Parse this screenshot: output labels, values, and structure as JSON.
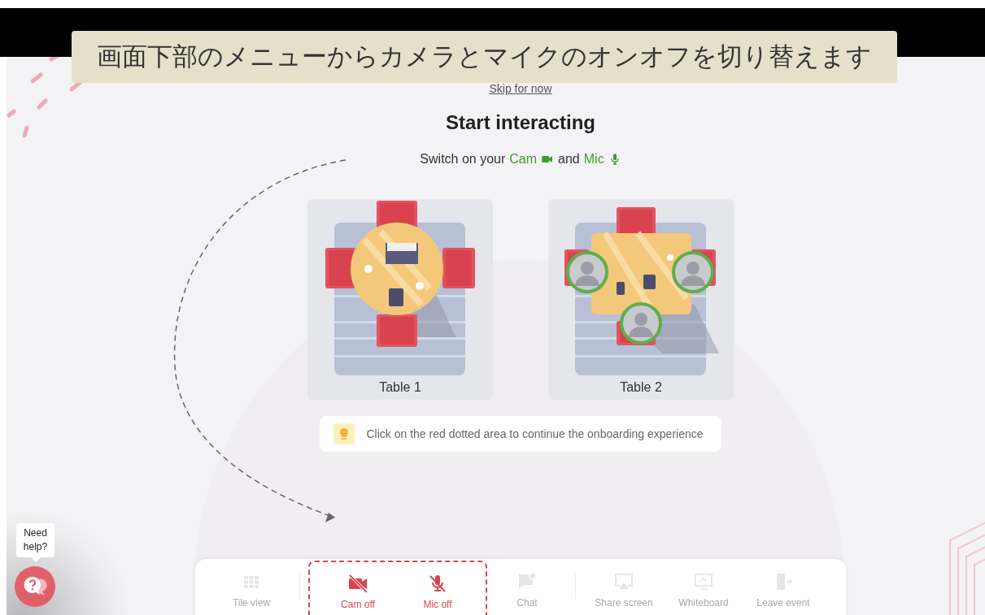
{
  "caption": {
    "text": "画面下部のメニューからカメラとマイクのオンオフを切り替えます"
  },
  "skip_link": "Skip for now",
  "heading": "Start interacting",
  "subtitle": [
    {
      "text": "Switch on your",
      "kind": "plain"
    },
    {
      "text": "Cam",
      "kind": "cam"
    },
    {
      "text": "and",
      "kind": "plain"
    },
    {
      "text": "Mic",
      "kind": "mic"
    }
  ],
  "tables": [
    {
      "label": "Table 1",
      "kind": "round"
    },
    {
      "label": "Table 2",
      "kind": "rect"
    }
  ],
  "hint": "Click on the red dotted area to continue the onboarding experience",
  "toolbar": [
    {
      "kind": "tile",
      "label": "Tile view",
      "disabled": true,
      "highlighted": false
    },
    {
      "kind": "divider"
    },
    {
      "kind": "cam",
      "label": "Cam off",
      "disabled": false,
      "highlighted": true
    },
    {
      "kind": "mic",
      "label": "Mic off",
      "disabled": false,
      "highlighted": true
    },
    {
      "kind": "chat",
      "label": "Chat",
      "disabled": true,
      "highlighted": false
    },
    {
      "kind": "divider"
    },
    {
      "kind": "share",
      "label": "Share screen",
      "disabled": true,
      "highlighted": false
    },
    {
      "kind": "whiteboard",
      "label": "Whiteboard",
      "disabled": true,
      "highlighted": false
    },
    {
      "kind": "leave",
      "label": "Leave event",
      "disabled": true,
      "highlighted": false
    }
  ],
  "help": {
    "tooltip": "Need help?"
  }
}
